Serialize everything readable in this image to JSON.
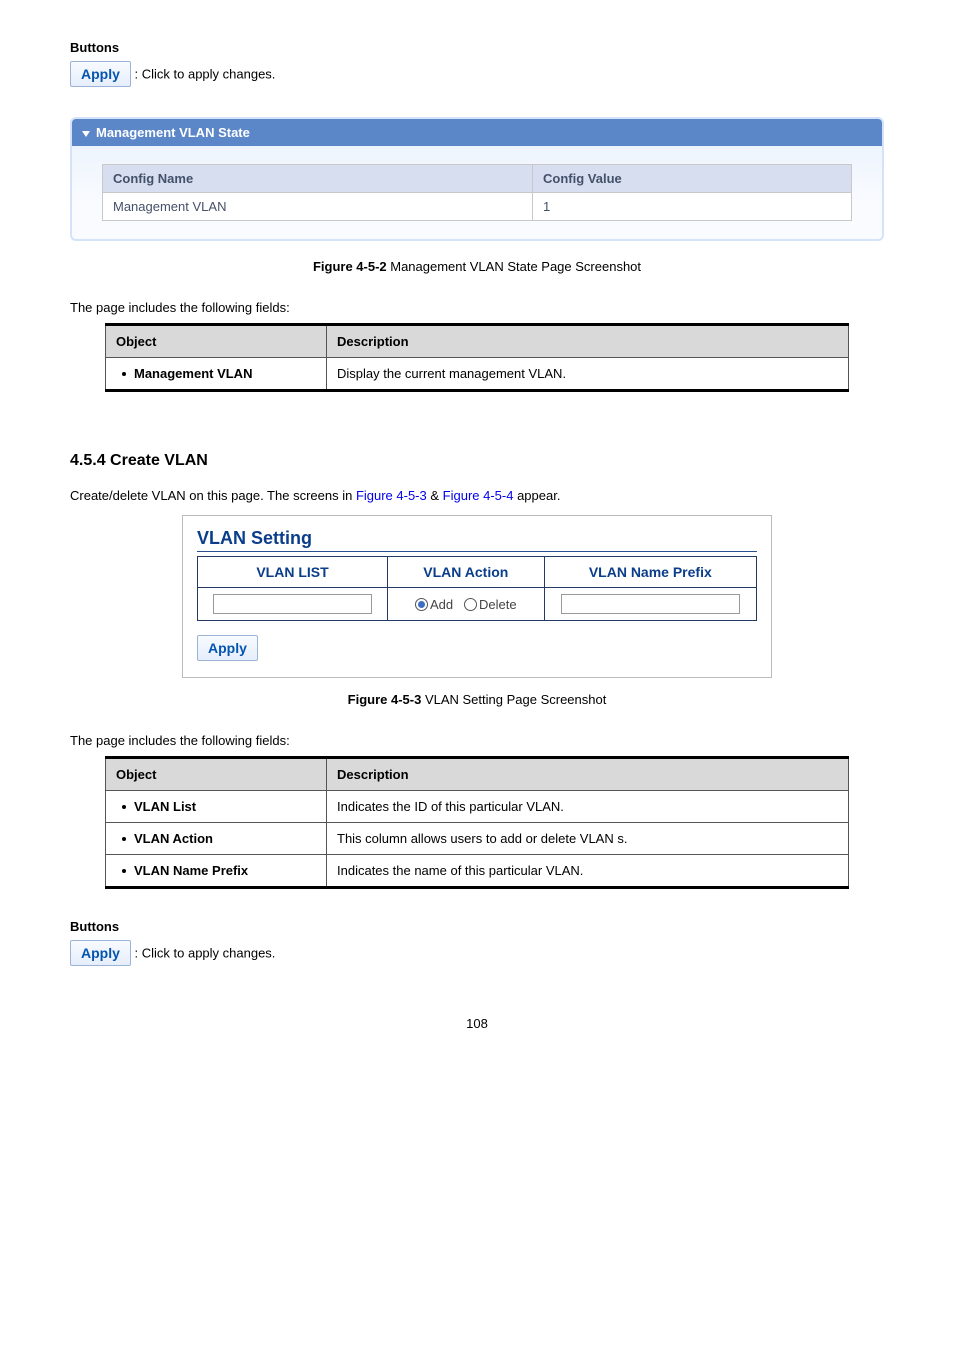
{
  "buttons_heading": "Buttons",
  "apply_label": "Apply",
  "apply_desc": ": Click to apply changes.",
  "state_panel": {
    "title": "Management VLAN State",
    "col_name": "Config Name",
    "col_value": "Config Value",
    "row_name": "Management VLAN",
    "row_value": "1"
  },
  "figure_452_prefix": "Figure 4-5-2",
  "figure_452_text": " Management VLAN State Page Screenshot",
  "fields_intro": "The page includes the following fields:",
  "obj_table1": {
    "h1": "Object",
    "h2": "Description",
    "r1_term": "Management VLAN",
    "r1_desc": "Display the current management VLAN."
  },
  "section_454": "4.5.4 Create VLAN",
  "section_454_intro_a": "Create/delete VLAN on this page. The screens in ",
  "section_454_link1": "Figure 4-5-3",
  "section_454_amp": " & ",
  "section_454_link2": "Figure 4-5-4",
  "section_454_intro_b": " appear.",
  "vlan_setting": {
    "title": "VLAN Setting",
    "col_list": "VLAN LIST",
    "col_action": "VLAN Action",
    "col_prefix": "VLAN Name Prefix",
    "radio_add": "Add",
    "radio_delete": "Delete",
    "apply": "Apply"
  },
  "figure_453_prefix": "Figure 4-5-3",
  "figure_453_text": " VLAN Setting Page Screenshot",
  "obj_table2": {
    "h1": "Object",
    "h2": "Description",
    "r1_term": "VLAN List",
    "r1_desc": "Indicates the ID of this particular VLAN.",
    "r2_term": "VLAN Action",
    "r2_desc": "This column allows users to add or delete VLAN s.",
    "r3_term": "VLAN Name Prefix",
    "r3_desc": "Indicates the name of this particular VLAN."
  },
  "page_number": "108"
}
